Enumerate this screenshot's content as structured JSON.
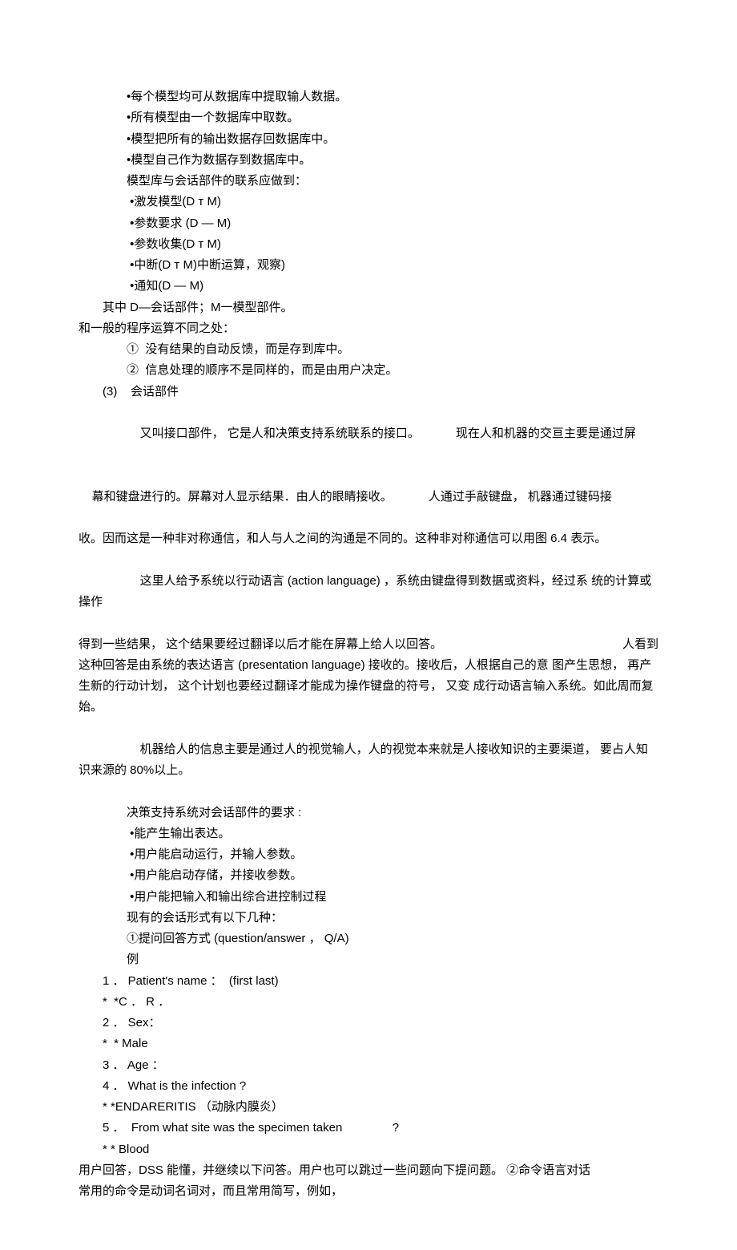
{
  "bullets_db": [
    "•每个模型均可从数据库中提取输人数据。",
    "•所有模型由一个数据库中取数。",
    "•模型把所有的输出数据存回数据库中。",
    "•模型自己作为数据存到数据库中。"
  ],
  "model_dialog_heading": "模型库与会话部件的联系应做到：",
  "bullets_dm": [
    " •激发模型(D т M)",
    " •参数要求 (D — M)",
    " •参数收集(D т M)",
    " •中断(D т M)中断运算，观察)",
    " •通知(D — M)"
  ],
  "dm_note": "其中 D—会话部件；M一模型部件。",
  "diff_heading": "和一般的程序运算不同之处：",
  "diff_points": [
    "①  没有结果的自动反馈，而是存到库中。",
    "②  信息处理的顺序不是同样的，而是由用户决定。"
  ],
  "section3_label": "(3)    会话部件",
  "para1a": "又叫接口部件， 它是人和决策支持系统联系的接口。",
  "para1b": "现在人和机器的交亘主要是通过屏",
  "para2a": "幕和键盘进行的。屏幕对人显示结果．由人的眼睛接收。",
  "para2b": "人通过手敲键盘， 机器通过键码接",
  "para3": "收。因而这是一种非对称通信，和人与人之间的沟通是不同的。这种非对称通信可以用图 6.4 表示。",
  "para4a": "这里人给予系统以行动语言 (action language) ，系统由键盘得到数据或资料，经过系 统的计算或操作",
  "para4b": "得到一些结果， 这个结果要经过翻译以后才能在屏幕上给人以回答。",
  "para4c": "人看到",
  "para5": "这种回答是由系统的表达语言 (presentation language) 接收的。接收后，人根据自己的意 图产生思想， 再产生新的行动计划， 这个计划也要经过翻译才能成为操作键盘的符号， 又变 成行动语言输入系统。如此周而复始。",
  "para6": "机器给人的信息主要是通过人的视觉输人，人的视觉本来就是人接收知识的主要渠道， 要占人知识来源的 80%以上。",
  "req_heading": "决策支持系统对会话部件的要求 :",
  "req_points": [
    " •能产生输出表达。",
    " •用户能启动运行，并输人参数。",
    " •用户能启动存储，并接收参数。",
    " •用户能把输入和输出综合进控制过程"
  ],
  "form_heading": "现有的会话形式有以下几种：",
  "form1": "①提问回答方式 (question/answer ， Q/A)",
  "example_label": "例",
  "qa": [
    "1 ． Patient's name ：  (first last)",
    "*  *C ． R ．",
    "2 ． Sex：",
    "*  * Male",
    "3 ． Age ：",
    "4 ． What is the infection ?",
    "* *ENDARERITIS （动脉内膜炎）",
    "5 ．  From what site was the specimen taken               ?",
    "* * Blood"
  ],
  "closing1": "用户回答，DSS 能懂，并继续以下问答。用户也可以跳过一些问题向下提问题。 ②命令语言对话",
  "closing2": "常用的命令是动词名词对，而且常用简写，例如，"
}
